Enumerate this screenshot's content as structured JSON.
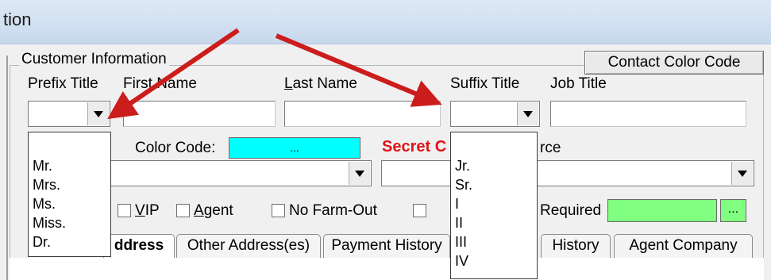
{
  "window": {
    "title": "tion"
  },
  "group": {
    "legend": "Customer Information",
    "contact_color_button": "Contact Color Code"
  },
  "labels": {
    "prefix_title": "Prefix Title",
    "first_name": "First Name",
    "last_name": "Last Name",
    "last_name_underline": "L",
    "last_name_rest": "ast Name",
    "suffix_title": "Suffix Title",
    "job_title": "Job Title",
    "color_code": "Color Code:",
    "color_btn": "...",
    "secret": "Secret C",
    "source_fragment": "rce",
    "required": "Required",
    "required_btn": "..."
  },
  "colors": {
    "color_code_swatch": "#00ffff",
    "required_swatch": "#80ff80",
    "secret_text": "#e0121b",
    "arrow": "#cc1d1d"
  },
  "checkboxes": {
    "vip": "VIP",
    "vip_u": "V",
    "vip_rest": "IP",
    "agent": "Agent",
    "agent_u": "A",
    "agent_rest": "gent",
    "no_farm_out": "No Farm-Out"
  },
  "prefix_options": [
    "Mr.",
    "Mrs.",
    "Ms.",
    "Miss.",
    "Dr."
  ],
  "suffix_options": [
    "Jr.",
    "Sr.",
    "I",
    "II",
    "III",
    "IV"
  ],
  "tabs": {
    "address": "ddress",
    "other_address": "Other Address(es)",
    "payment_history": "Payment History",
    "history": "History",
    "agent_company": "Agent Company"
  }
}
